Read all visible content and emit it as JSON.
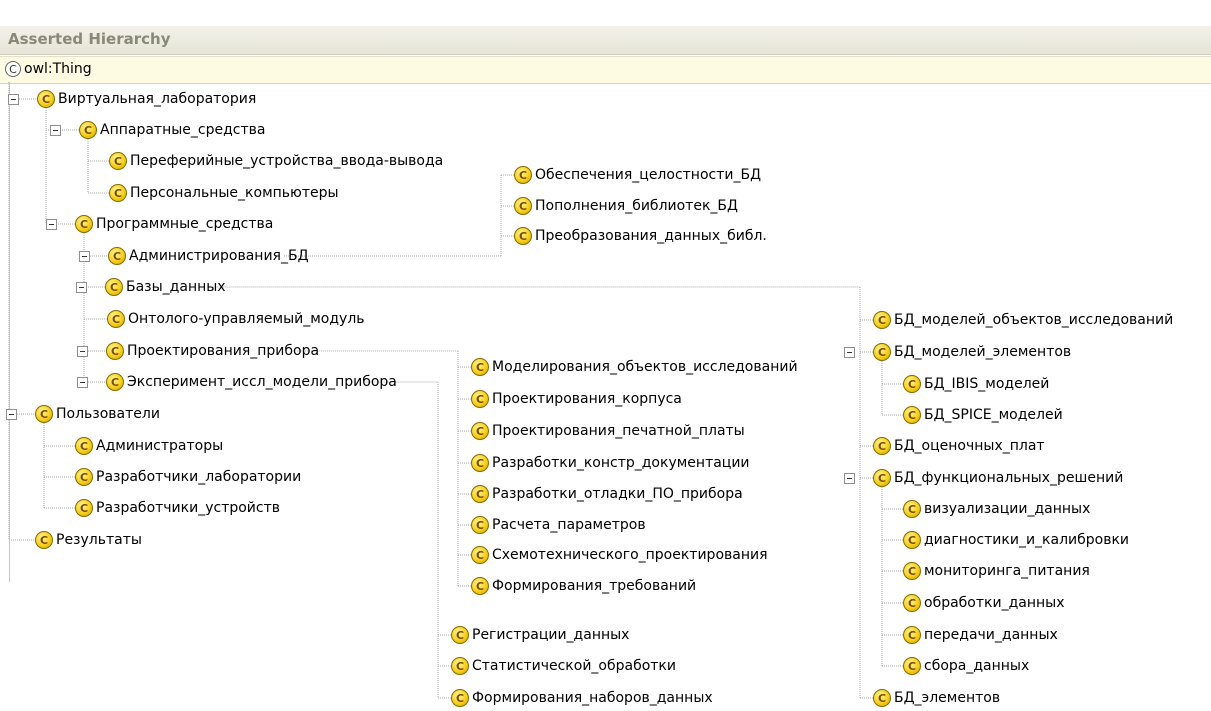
{
  "panel_title": "Asserted Hierarchy",
  "class_icon_letter": "C",
  "root": {
    "label": "owl:Thing"
  },
  "nodes": [
    "Виртуальная_лаборатория",
    "Аппаратные_средства",
    "Переферийные_устройства_ввода-вывода",
    "Персональные_компьютеры",
    "Программные_средства",
    "Администрирования_БД",
    "Базы_данных",
    "Онтолого-управляемый_модуль",
    "Проектирования_прибора",
    "Эксперимент_иссл_модели_прибора",
    "Пользователи",
    "Администраторы",
    "Разработчики_лаборатории",
    "Разработчики_устройств",
    "Результаты",
    "Обеспечения_целостности_БД",
    "Пополнения_библиотек_БД",
    "Преобразования_данных_библ.",
    "Моделирования_объектов_исследований",
    "Проектирования_корпуса",
    "Проектирования_печатной_платы",
    "Разработки_констр_документации",
    "Разработки_отладки_ПО_прибора",
    "Расчета_параметров",
    "Схемотехнического_проектирования",
    "Формирования_требований",
    "Регистрации_данных",
    "Статистической_обработки",
    "Формирования_наборов_данных",
    "БД_моделей_объектов_исследований",
    "БД_моделей_элементов",
    "БД_IBIS_моделей",
    "БД_SPICE_моделей",
    "БД_оценочных_плат",
    "БД_функциональных_решений",
    "визуализации_данных",
    "диагностики_и_калибровки",
    "мониторинга_питания",
    "обработки_данных",
    "передачи_данных",
    "сбора_данных",
    "БД_элементов"
  ],
  "edges": [
    [
      0,
      1
    ],
    [
      1,
      2
    ],
    [
      1,
      3
    ],
    [
      0,
      4
    ],
    [
      4,
      5
    ],
    [
      4,
      6
    ],
    [
      4,
      7
    ],
    [
      4,
      8
    ],
    [
      4,
      9
    ],
    [
      10,
      11
    ],
    [
      10,
      12
    ],
    [
      10,
      13
    ],
    [
      5,
      15
    ],
    [
      5,
      16
    ],
    [
      5,
      17
    ],
    [
      8,
      18
    ],
    [
      8,
      19
    ],
    [
      8,
      20
    ],
    [
      8,
      21
    ],
    [
      8,
      22
    ],
    [
      8,
      23
    ],
    [
      8,
      24
    ],
    [
      8,
      25
    ],
    [
      9,
      26
    ],
    [
      9,
      27
    ],
    [
      9,
      28
    ],
    [
      6,
      29
    ],
    [
      6,
      30
    ],
    [
      30,
      31
    ],
    [
      30,
      32
    ],
    [
      6,
      33
    ],
    [
      6,
      34
    ],
    [
      34,
      35
    ],
    [
      34,
      36
    ],
    [
      34,
      37
    ],
    [
      34,
      38
    ],
    [
      34,
      39
    ],
    [
      34,
      40
    ],
    [
      6,
      41
    ]
  ],
  "root_children": [
    0,
    10,
    14
  ],
  "expanded": [
    0,
    1,
    4,
    5,
    6,
    8,
    9,
    10,
    30,
    34
  ]
}
